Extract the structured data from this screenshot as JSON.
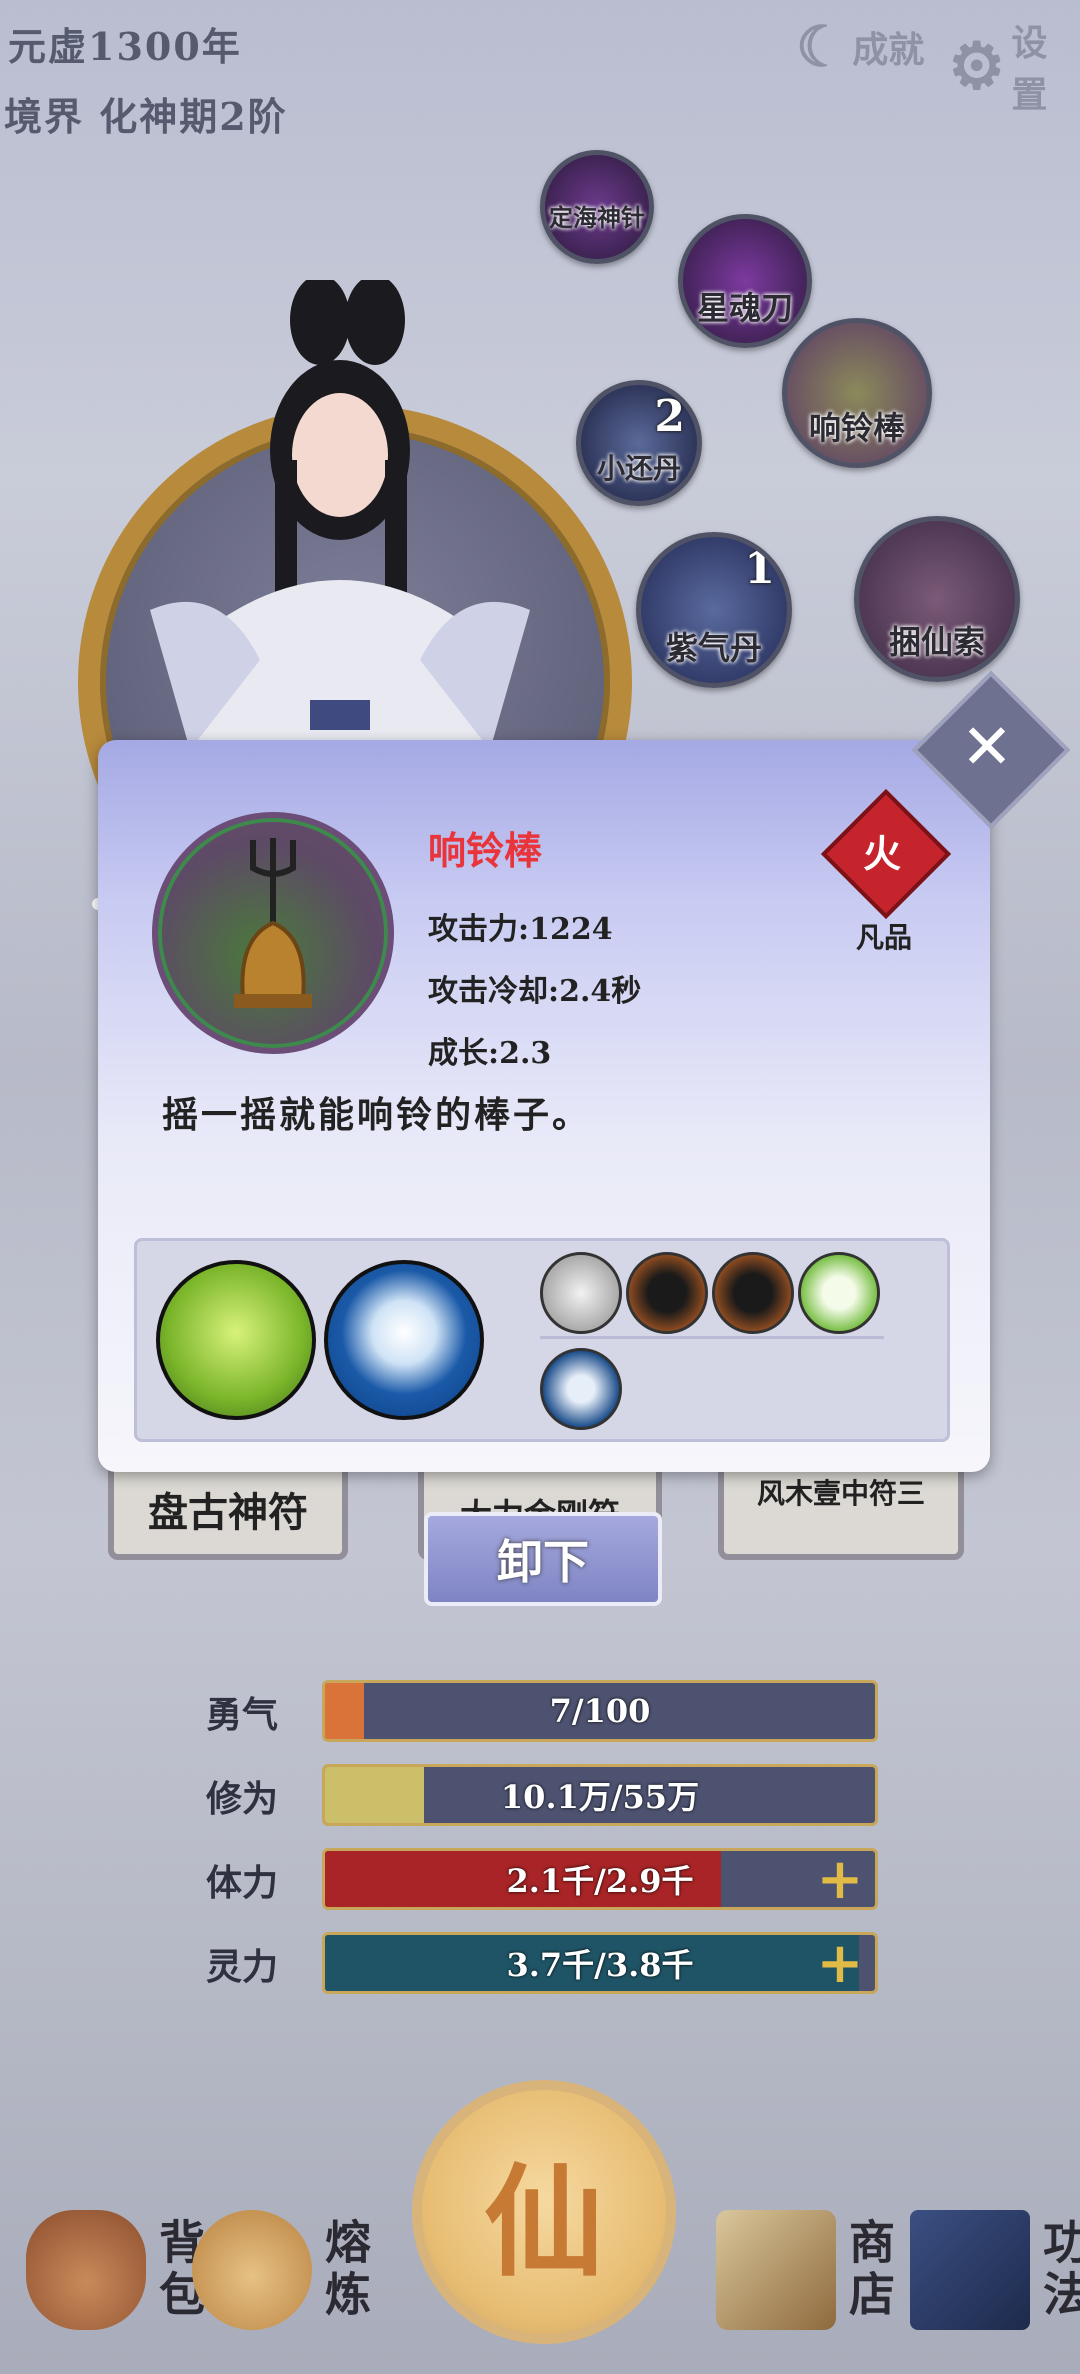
{
  "hud": {
    "era": "元虚1300年",
    "realm": "境界 化神期2阶",
    "achievement_label": "成就",
    "settings_label": "设置"
  },
  "equipment_ring": [
    {
      "label": "定海神针",
      "count": ""
    },
    {
      "label": "星魂刀",
      "count": ""
    },
    {
      "label": "响铃棒",
      "count": ""
    },
    {
      "label": "小还丹",
      "count": "2"
    },
    {
      "label": "紫气丹",
      "count": "1"
    },
    {
      "label": "捆仙索",
      "count": ""
    }
  ],
  "popup": {
    "close": "✕",
    "item_name": "响铃棒",
    "attack": "攻击力:1224",
    "cooldown": "攻击冷却:2.4秒",
    "growth": "成长:2.3",
    "element": "火",
    "grade": "凡品",
    "description": "摇一摇就能响铃的棒子。"
  },
  "cards": [
    {
      "title": "盘古神符"
    },
    {
      "title": "大力金刚符"
    },
    {
      "title": "风木壹中符三"
    }
  ],
  "unload_label": "卸下",
  "bars": [
    {
      "label": "勇气",
      "text": "7/100",
      "fraction": 0.07,
      "color": "#d9733a",
      "plus": false
    },
    {
      "label": "修为",
      "text": "10.1万/55万",
      "fraction": 0.18,
      "color": "#cbbf6a",
      "plus": false
    },
    {
      "label": "体力",
      "text": "2.1千/2.9千",
      "fraction": 0.72,
      "color": "#a82426",
      "plus": true
    },
    {
      "label": "灵力",
      "text": "3.7千/3.8千",
      "fraction": 0.97,
      "color": "#1f5466",
      "plus": true
    }
  ],
  "nav": {
    "center": "仙",
    "bag": "背包",
    "smelt": "熔炼",
    "shop": "商店",
    "skills": "功法"
  }
}
